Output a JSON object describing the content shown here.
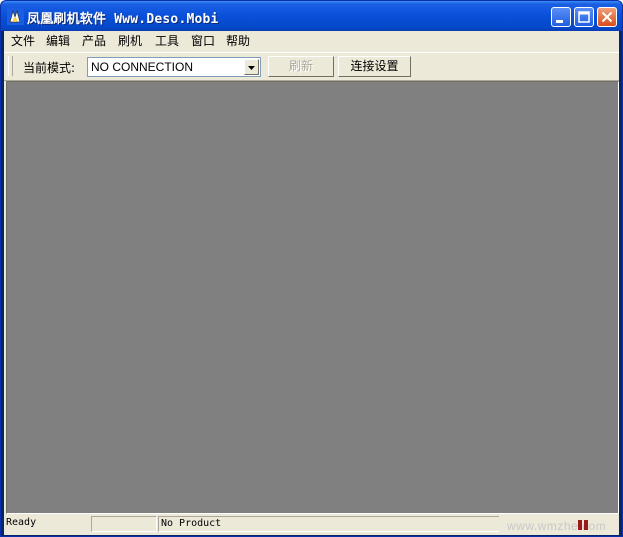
{
  "window": {
    "title": "凤凰刷机软件 Www.Deso.Mobi"
  },
  "menu": [
    "文件",
    "编辑",
    "产品",
    "刷机",
    "工具",
    "窗口",
    "帮助"
  ],
  "toolbar": {
    "mode_label": "当前模式:",
    "mode_value": "NO CONNECTION",
    "refresh_label": "刷新",
    "connect_settings_label": "连接设置"
  },
  "status": {
    "ready": "Ready",
    "pane2": "",
    "product": "No Product",
    "watermark": "www.wmzhe.com"
  },
  "colors": {
    "titlebar": "#0a4fd9",
    "workspace": "#808080",
    "chrome": "#ece9d8",
    "indicator": "#9a1b1b"
  }
}
